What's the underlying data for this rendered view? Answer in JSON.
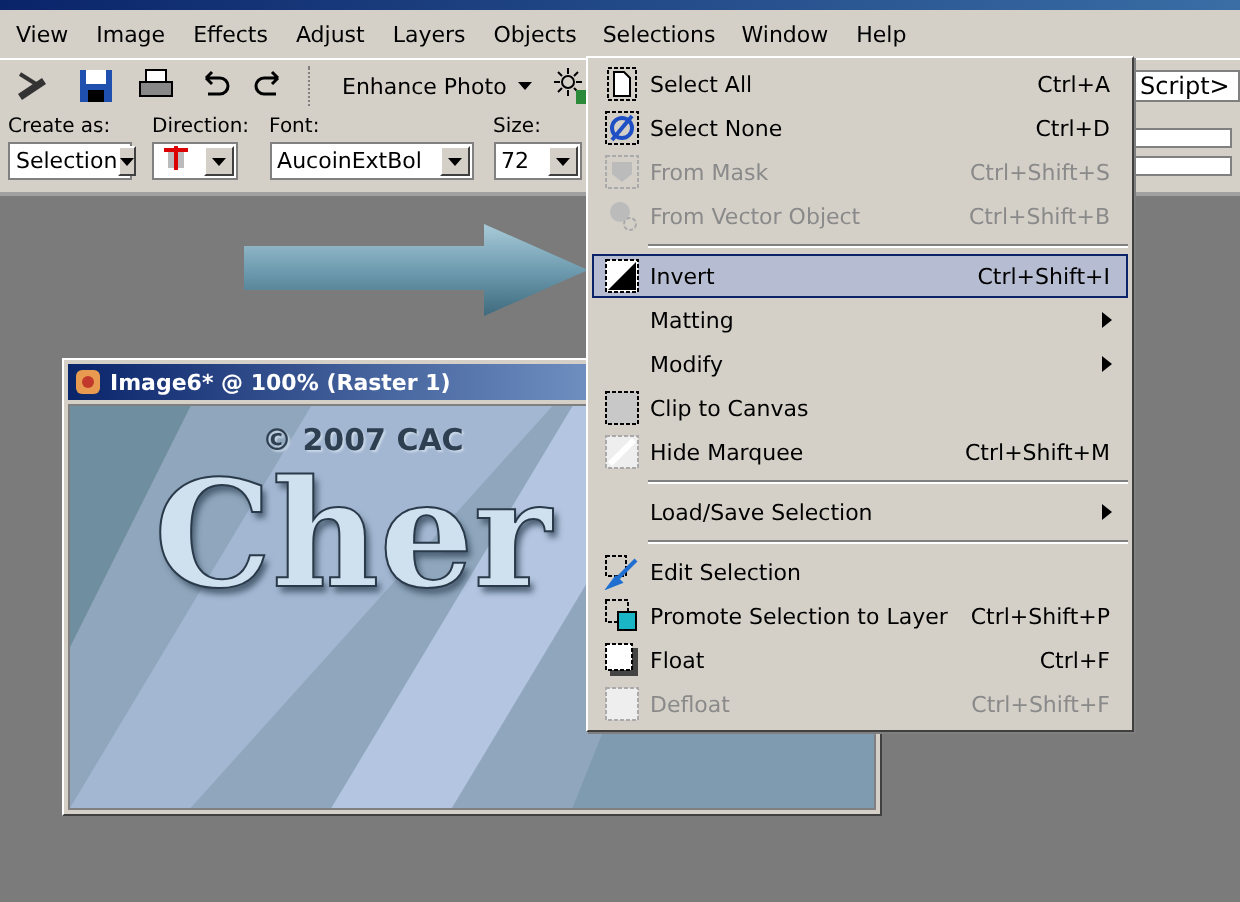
{
  "menu_bar": [
    {
      "label": "View",
      "selected": false
    },
    {
      "label": "Image",
      "selected": false
    },
    {
      "label": "Effects",
      "selected": false
    },
    {
      "label": "Adjust",
      "selected": false
    },
    {
      "label": "Layers",
      "selected": false
    },
    {
      "label": "Objects",
      "selected": false
    },
    {
      "label": "Selections",
      "selected": true
    },
    {
      "label": "Window",
      "selected": false
    },
    {
      "label": "Help",
      "selected": false
    }
  ],
  "toolbar": {
    "enhance_button": "Enhance Photo",
    "script_field": "Script>"
  },
  "tool_options": {
    "create_as": {
      "label": "Create as:",
      "value": "Selection"
    },
    "direction": {
      "label": "Direction:"
    },
    "font": {
      "label": "Font:",
      "value": "AucoinExtBol"
    },
    "size": {
      "label": "Size:",
      "value": "72"
    }
  },
  "image_window": {
    "title": "Image6* @ 100% (Raster 1)",
    "canvas_texts": [
      "© 2007 CAC",
      "Cher"
    ]
  },
  "selections_menu": [
    {
      "kind": "item",
      "label": "Select All",
      "shortcut": "Ctrl+A",
      "disabled": false,
      "selected": false
    },
    {
      "kind": "item",
      "label": "Select None",
      "shortcut": "Ctrl+D",
      "disabled": false,
      "selected": false
    },
    {
      "kind": "item",
      "label": "From Mask",
      "shortcut": "Ctrl+Shift+S",
      "disabled": true,
      "selected": false
    },
    {
      "kind": "item",
      "label": "From Vector Object",
      "shortcut": "Ctrl+Shift+B",
      "disabled": true,
      "selected": false
    },
    {
      "kind": "separator"
    },
    {
      "kind": "item",
      "label": "Invert",
      "shortcut": "Ctrl+Shift+I",
      "disabled": false,
      "selected": true
    },
    {
      "kind": "submenu",
      "label": "Matting",
      "disabled": false,
      "selected": false
    },
    {
      "kind": "submenu",
      "label": "Modify",
      "disabled": false,
      "selected": false
    },
    {
      "kind": "item",
      "label": "Clip to Canvas",
      "disabled": false,
      "selected": false
    },
    {
      "kind": "item",
      "label": "Hide Marquee",
      "shortcut": "Ctrl+Shift+M",
      "disabled": false,
      "selected": false
    },
    {
      "kind": "separator"
    },
    {
      "kind": "submenu",
      "label": "Load/Save Selection",
      "disabled": false,
      "selected": false
    },
    {
      "kind": "separator"
    },
    {
      "kind": "item",
      "label": "Edit Selection",
      "disabled": false,
      "selected": false
    },
    {
      "kind": "item",
      "label": "Promote Selection to Layer",
      "shortcut": "Ctrl+Shift+P",
      "disabled": false,
      "selected": false
    },
    {
      "kind": "item",
      "label": "Float",
      "shortcut": "Ctrl+F",
      "disabled": false,
      "selected": false
    },
    {
      "kind": "item",
      "label": "Defloat",
      "shortcut": "Ctrl+Shift+F",
      "disabled": true,
      "selected": false
    }
  ]
}
